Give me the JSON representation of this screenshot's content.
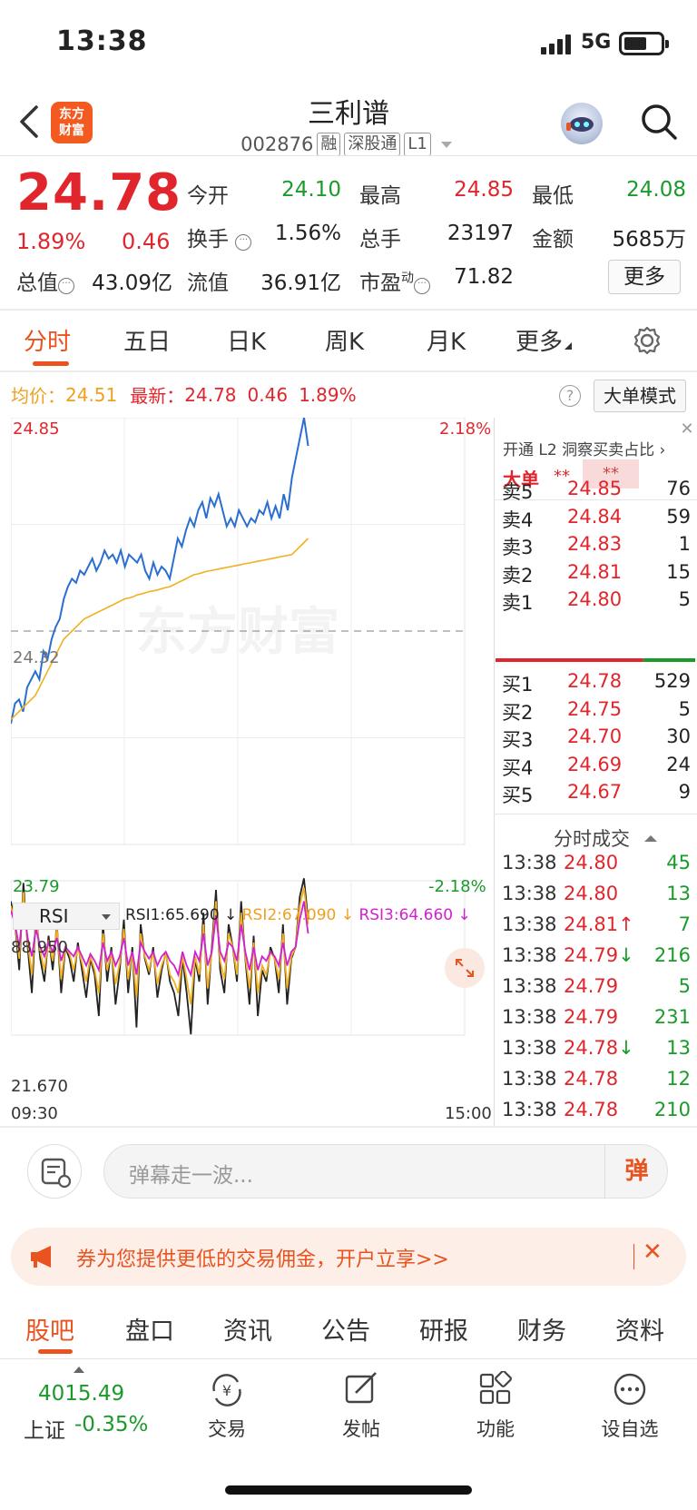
{
  "status": {
    "time": "13:38",
    "network": "5G"
  },
  "header": {
    "logo_line1": "东方",
    "logo_line2": "财富",
    "title": "三利谱",
    "code": "002876",
    "tags": [
      "融",
      "深股通",
      "L1"
    ]
  },
  "quote": {
    "price": "24.78",
    "change_pct": "1.89%",
    "change": "0.46",
    "fields": [
      {
        "label": "今开",
        "value": "24.10",
        "color": "green"
      },
      {
        "label": "最高",
        "value": "24.85",
        "color": "red"
      },
      {
        "label": "最低",
        "value": "24.08",
        "color": "green"
      },
      {
        "label": "换手",
        "value": "1.56%",
        "color": "plain"
      },
      {
        "label": "总手",
        "value": "23197",
        "color": "plain"
      },
      {
        "label": "金额",
        "value": "5685万",
        "color": "plain"
      },
      {
        "label": "总值",
        "value": "43.09亿",
        "color": "plain"
      },
      {
        "label": "流值",
        "value": "36.91亿",
        "color": "plain"
      },
      {
        "label": "市盈",
        "label_sup": "动",
        "value": "71.82",
        "color": "plain"
      }
    ],
    "more_button": "更多"
  },
  "tabs": [
    "分时",
    "五日",
    "日K",
    "周K",
    "月K",
    "更多"
  ],
  "info": {
    "avg_label": "均价：",
    "avg_value": "24.51",
    "latest_label": "最新：",
    "latest_value": "24.78",
    "latest_change": "0.46",
    "latest_pct": "1.89%",
    "bigorder_mode": "大单模式"
  },
  "chart_data": {
    "type": "line",
    "price_axis": {
      "top": "24.85",
      "mid": "24.32",
      "bottom": "23.79",
      "top_pct": "2.18%",
      "bottom_pct": "-2.18%"
    },
    "time_axis": {
      "start": "09:30",
      "end": "15:00"
    },
    "ylim": [
      23.79,
      24.85
    ],
    "series": [
      {
        "color": "#2a6fd0",
        "values": [
          24.09,
          24.14,
          24.15,
          24.12,
          24.18,
          24.2,
          24.22,
          24.2,
          24.27,
          24.25,
          24.3,
          24.33,
          24.35,
          24.4,
          24.43,
          24.45,
          24.44,
          24.47,
          24.46,
          24.48,
          24.5,
          24.47,
          24.49,
          24.52,
          24.5,
          24.51,
          24.49,
          24.52,
          24.48,
          24.51,
          24.5,
          24.49,
          24.51,
          24.47,
          24.45,
          24.49,
          24.46,
          24.48,
          24.47,
          24.45,
          24.5,
          24.55,
          24.53,
          24.57,
          24.6,
          24.58,
          24.62,
          24.64,
          24.6,
          24.65,
          24.63,
          24.66,
          24.62,
          24.58,
          24.6,
          24.58,
          24.62,
          24.6,
          24.58,
          24.6,
          24.59,
          24.62,
          24.61,
          24.64,
          24.6,
          24.63,
          24.6,
          24.66,
          24.62,
          24.7,
          24.75,
          24.8,
          24.85,
          24.78
        ]
      },
      {
        "color": "#f0b020",
        "values": [
          24.1,
          24.11,
          24.12,
          24.13,
          24.14,
          24.15,
          24.16,
          24.18,
          24.2,
          24.22,
          24.24,
          24.26,
          24.28,
          24.3,
          24.31,
          24.32,
          24.33,
          24.34,
          24.35,
          24.355,
          24.36,
          24.365,
          24.37,
          24.375,
          24.38,
          24.385,
          24.39,
          24.395,
          24.4,
          24.402,
          24.405,
          24.41,
          24.412,
          24.415,
          24.418,
          24.42,
          24.422,
          24.425,
          24.428,
          24.43,
          24.435,
          24.44,
          24.445,
          24.45,
          24.455,
          24.46,
          24.462,
          24.465,
          24.468,
          24.47,
          24.472,
          24.474,
          24.476,
          24.478,
          24.48,
          24.482,
          24.484,
          24.486,
          24.488,
          24.49,
          24.492,
          24.494,
          24.496,
          24.498,
          24.5,
          24.502,
          24.504,
          24.506,
          24.508,
          24.51,
          24.52,
          24.53,
          24.54,
          24.55
        ]
      }
    ],
    "ref_line": 24.32,
    "watermark": "东方财富"
  },
  "rsi": {
    "selector": "RSI",
    "rsi1": "RSI1:65.690",
    "rsi2": "RSI2:67.090",
    "rsi3": "RSI3:64.660",
    "max_label": "88.950",
    "min_label": "21.670",
    "ylim": [
      21.67,
      88.95
    ],
    "series": [
      {
        "name": "RSI1",
        "color": "#222222",
        "values": [
          80,
          70,
          50,
          88,
          60,
          40,
          75,
          55,
          45,
          65,
          50,
          70,
          40,
          60,
          55,
          45,
          62,
          50,
          38,
          55,
          48,
          30,
          70,
          45,
          60,
          35,
          50,
          72,
          40,
          60,
          25,
          70,
          55,
          48,
          60,
          38,
          50,
          58,
          45,
          40,
          30,
          55,
          40,
          22,
          55,
          45,
          75,
          35,
          60,
          85,
          50,
          40,
          70,
          60,
          45,
          80,
          55,
          35,
          65,
          30,
          50,
          45,
          60,
          55,
          40,
          70,
          35,
          55,
          60,
          82,
          90,
          72
        ]
      },
      {
        "name": "RSI2",
        "color": "#f0b020",
        "values": [
          78,
          70,
          55,
          84,
          62,
          48,
          72,
          58,
          50,
          63,
          54,
          68,
          46,
          60,
          57,
          50,
          60,
          53,
          45,
          56,
          50,
          40,
          66,
          50,
          58,
          44,
          53,
          68,
          46,
          58,
          38,
          66,
          56,
          50,
          58,
          44,
          52,
          57,
          48,
          45,
          40,
          56,
          46,
          35,
          56,
          48,
          70,
          42,
          58,
          80,
          54,
          46,
          66,
          60,
          48,
          75,
          56,
          42,
          62,
          40,
          52,
          48,
          58,
          55,
          46,
          66,
          42,
          56,
          60,
          78,
          86,
          70
        ]
      },
      {
        "name": "RSI3",
        "color": "#d020d0",
        "values": [
          76,
          70,
          60,
          78,
          64,
          56,
          68,
          60,
          56,
          62,
          58,
          64,
          54,
          60,
          58,
          56,
          60,
          56,
          52,
          57,
          54,
          50,
          62,
          54,
          58,
          52,
          56,
          64,
          52,
          58,
          48,
          62,
          58,
          55,
          58,
          52,
          56,
          58,
          54,
          52,
          48,
          58,
          52,
          48,
          58,
          54,
          66,
          52,
          58,
          74,
          58,
          54,
          62,
          60,
          54,
          70,
          58,
          50,
          60,
          50,
          56,
          54,
          58,
          56,
          52,
          62,
          52,
          58,
          60,
          72,
          80,
          66
        ]
      }
    ]
  },
  "orderbook": {
    "close": "✕",
    "l2_text": "开通 L2 洞察买卖占比 ›",
    "bigorder_label": "大单",
    "stars": "**",
    "asks": [
      {
        "label": "卖5",
        "price": "24.85",
        "vol": "76"
      },
      {
        "label": "卖4",
        "price": "24.84",
        "vol": "59"
      },
      {
        "label": "卖3",
        "price": "24.83",
        "vol": "1"
      },
      {
        "label": "卖2",
        "price": "24.81",
        "vol": "15"
      },
      {
        "label": "卖1",
        "price": "24.80",
        "vol": "5"
      }
    ],
    "bids": [
      {
        "label": "买1",
        "price": "24.78",
        "vol": "529"
      },
      {
        "label": "买2",
        "price": "24.75",
        "vol": "5"
      },
      {
        "label": "买3",
        "price": "24.70",
        "vol": "30"
      },
      {
        "label": "买4",
        "price": "24.69",
        "vol": "24"
      },
      {
        "label": "买5",
        "price": "24.67",
        "vol": "9"
      }
    ],
    "ask_bid_ratio": 0.74,
    "trades_title": "分时成交",
    "trades": [
      {
        "time": "13:38",
        "price": "24.80",
        "arrow": "",
        "vol": "45",
        "dir": "buy"
      },
      {
        "time": "13:38",
        "price": "24.80",
        "arrow": "",
        "vol": "13",
        "dir": "buy"
      },
      {
        "time": "13:38",
        "price": "24.81",
        "arrow": "↑",
        "vol": "7",
        "dir": "buy"
      },
      {
        "time": "13:38",
        "price": "24.79",
        "arrow": "↓",
        "vol": "216",
        "dir": "buy"
      },
      {
        "time": "13:38",
        "price": "24.79",
        "arrow": "",
        "vol": "5",
        "dir": "buy"
      },
      {
        "time": "13:38",
        "price": "24.79",
        "arrow": "",
        "vol": "231",
        "dir": "buy"
      },
      {
        "time": "13:38",
        "price": "24.78",
        "arrow": "↓",
        "vol": "13",
        "dir": "buy"
      },
      {
        "time": "13:38",
        "price": "24.78",
        "arrow": "",
        "vol": "12",
        "dir": "buy"
      },
      {
        "time": "13:38",
        "price": "24.78",
        "arrow": "",
        "vol": "210",
        "dir": "buy"
      }
    ]
  },
  "danmaku": {
    "placeholder": "弹幕走一波...",
    "send_label": "弹"
  },
  "banner": {
    "text": "券为您提供更低的交易佣金，开户立享>>",
    "close": "✕"
  },
  "bottom_tabs": [
    "股吧",
    "盘口",
    "资讯",
    "公告",
    "研报",
    "财务",
    "资料"
  ],
  "bottom_nav": {
    "index_value": "4015.49",
    "index_name": "上证",
    "index_change": "-0.35%",
    "items": [
      {
        "label": "交易",
        "icon": "yen-cycle-icon"
      },
      {
        "label": "发帖",
        "icon": "edit-icon"
      },
      {
        "label": "功能",
        "icon": "grid-icon"
      },
      {
        "label": "设自选",
        "icon": "more-dots-icon"
      }
    ]
  }
}
